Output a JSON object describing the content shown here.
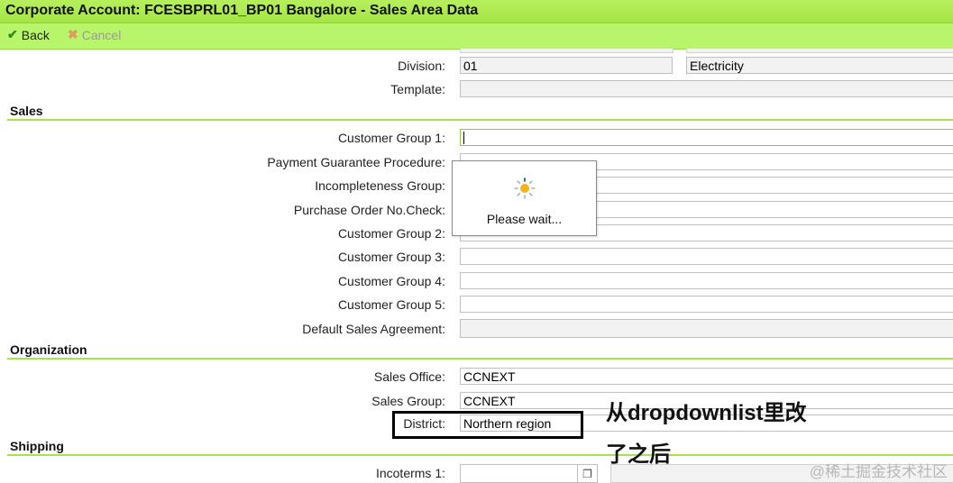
{
  "window": {
    "title": "Corporate Account: FCESBPRL01_BP01 Bangalore - Sales Area Data"
  },
  "toolbar": {
    "back_label": "Back",
    "cancel_label": "Cancel"
  },
  "general": {
    "division_label": "Division:",
    "division_code": "01",
    "division_desc": "Electricity",
    "template_label": "Template:",
    "template_value": ""
  },
  "sales": {
    "section_title": "Sales",
    "customer_group_1_label": "Customer Group 1:",
    "customer_group_1_value": "",
    "payment_guarantee_label": "Payment Guarantee Procedure:",
    "incompleteness_group_label": "Incompleteness Group:",
    "purchase_order_check_label": "Purchase Order No.Check:",
    "customer_group_2_label": "Customer Group 2:",
    "customer_group_3_label": "Customer Group 3:",
    "customer_group_4_label": "Customer Group 4:",
    "customer_group_5_label": "Customer Group 5:",
    "default_sales_agreement_label": "Default Sales Agreement:"
  },
  "organization": {
    "section_title": "Organization",
    "sales_office_label": "Sales Office:",
    "sales_office_value": "CCNEXT",
    "sales_group_label": "Sales Group:",
    "sales_group_value": "CCNEXT",
    "district_label": "District:",
    "district_value": "Northern region"
  },
  "shipping": {
    "section_title": "Shipping",
    "incoterms_1_label": "Incoterms 1:",
    "incoterms_1_value": ""
  },
  "loading_popup": {
    "message": "Please wait..."
  },
  "annotation": {
    "line1": "从dropdownlist里改",
    "line2": "了之后"
  },
  "watermark": "@稀土掘金技术社区",
  "icons": {
    "back": "check-icon",
    "cancel": "x-icon",
    "spinner": "spinner-icon",
    "value_help": "value-help-icon"
  },
  "colors": {
    "accent_green": "#a5e544",
    "toolbar_green": "#b9f56a"
  }
}
